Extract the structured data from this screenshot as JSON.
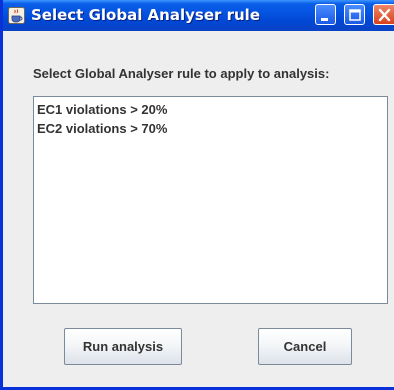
{
  "window": {
    "title": "Select Global Analyser rule",
    "icon": "java-cup-icon"
  },
  "titlebar_buttons": [
    "minimize-icon",
    "maximize-icon",
    "close-icon"
  ],
  "prompt": "Select Global Analyser rule to apply to analysis:",
  "rules": [
    {
      "label": "EC1 violations > 20%"
    },
    {
      "label": "EC2 violations > 70%"
    }
  ],
  "buttons": {
    "run": "Run analysis",
    "cancel": "Cancel"
  }
}
